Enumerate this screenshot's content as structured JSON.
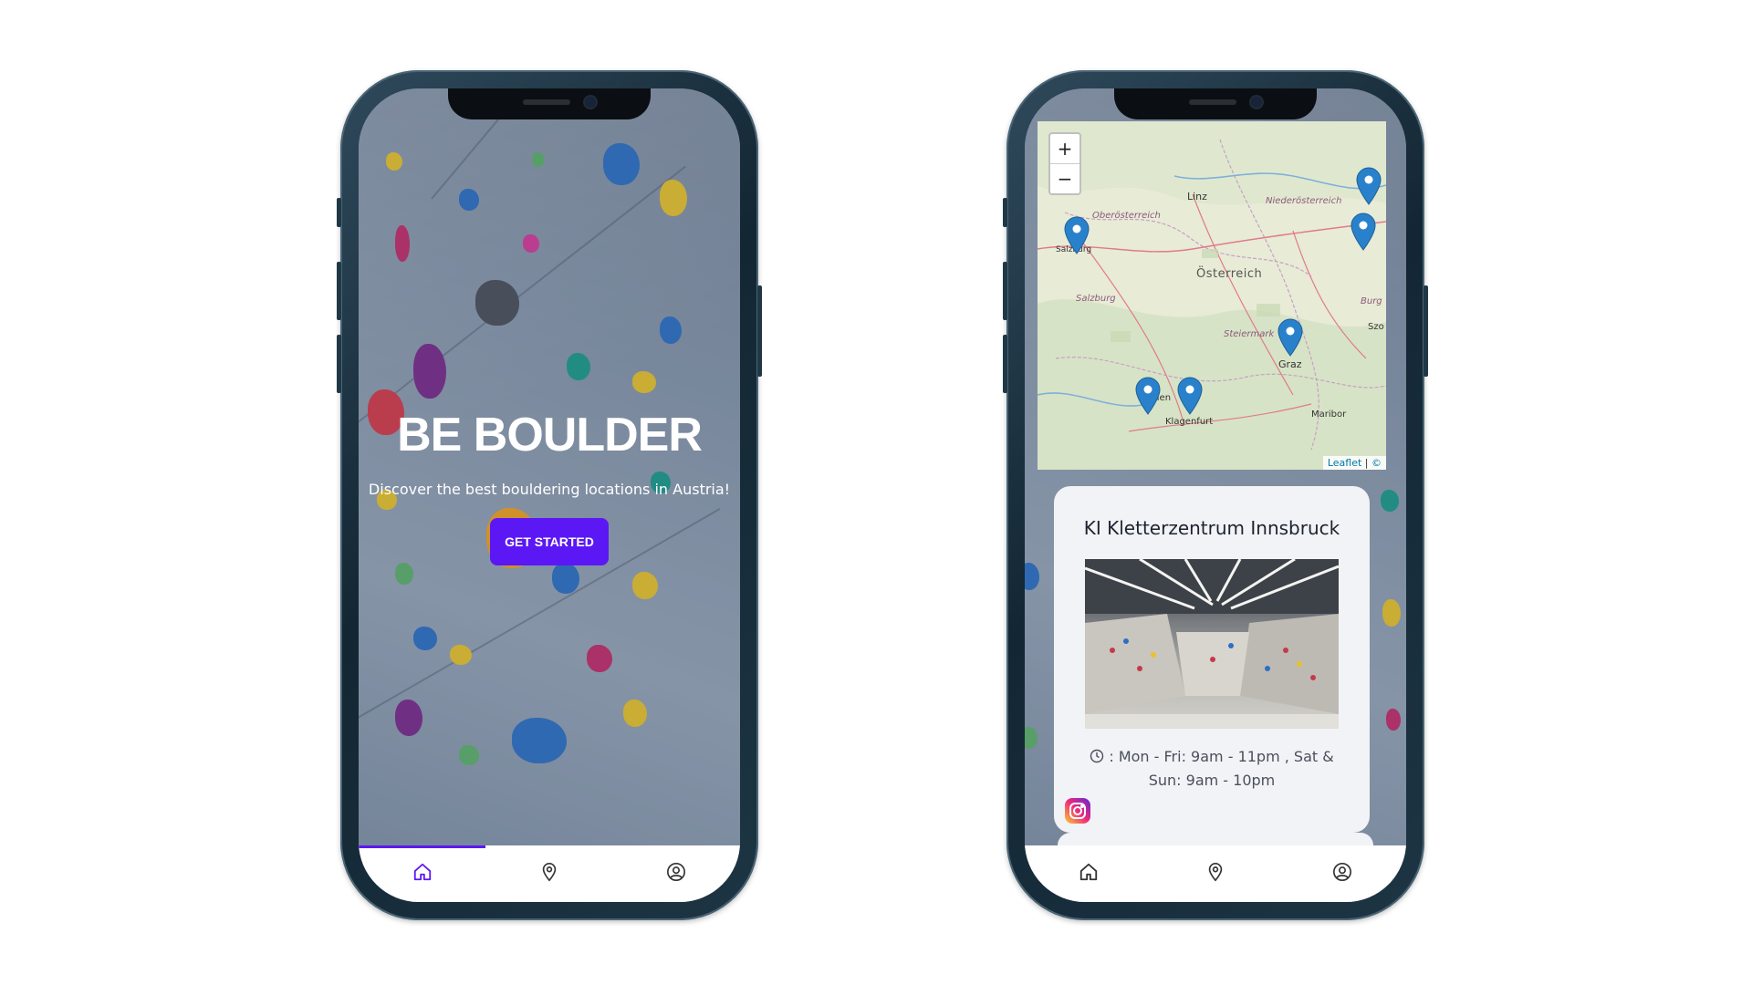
{
  "home_screen": {
    "title": "BE BOULDER",
    "subtitle": "Discover the best bouldering locations in Austria!",
    "cta_label": "GET STARTED",
    "active_tab": "home"
  },
  "map_screen": {
    "zoom_in_label": "+",
    "zoom_out_label": "−",
    "labels": {
      "linz": "Linz",
      "oberoesterreich": "Oberösterreich",
      "niederoesterreich": "Niederösterreich",
      "salzburg_city": "Salzburg",
      "salzburg_region": "Salzburg",
      "oesterreich": "Österreich",
      "steiermark": "Steiermark",
      "graz": "Graz",
      "klagenfurt": "Klagenfurt",
      "maribor": "Maribor",
      "burg": "Burg",
      "szo": "Szo",
      "villach_fragment": "llen"
    },
    "attribution": {
      "leaflet": "Leaflet",
      "separator": "|",
      "copyright": "©"
    }
  },
  "location_card": {
    "name": "KI Kletterzentrum Innsbruck",
    "hours_icon": "clock-icon",
    "hours": ": Mon - Fri: 9am - 11pm , Sat & Sun: 9am - 10pm",
    "social_icon": "instagram-icon"
  },
  "tabs": [
    {
      "name": "home",
      "icon": "home-icon"
    },
    {
      "name": "map",
      "icon": "map-pin-icon"
    },
    {
      "name": "profile",
      "icon": "user-circle-icon"
    }
  ],
  "colors": {
    "accent": "#5b18f5",
    "pin": "#2a81cb",
    "card_bg": "#f2f3f6"
  }
}
